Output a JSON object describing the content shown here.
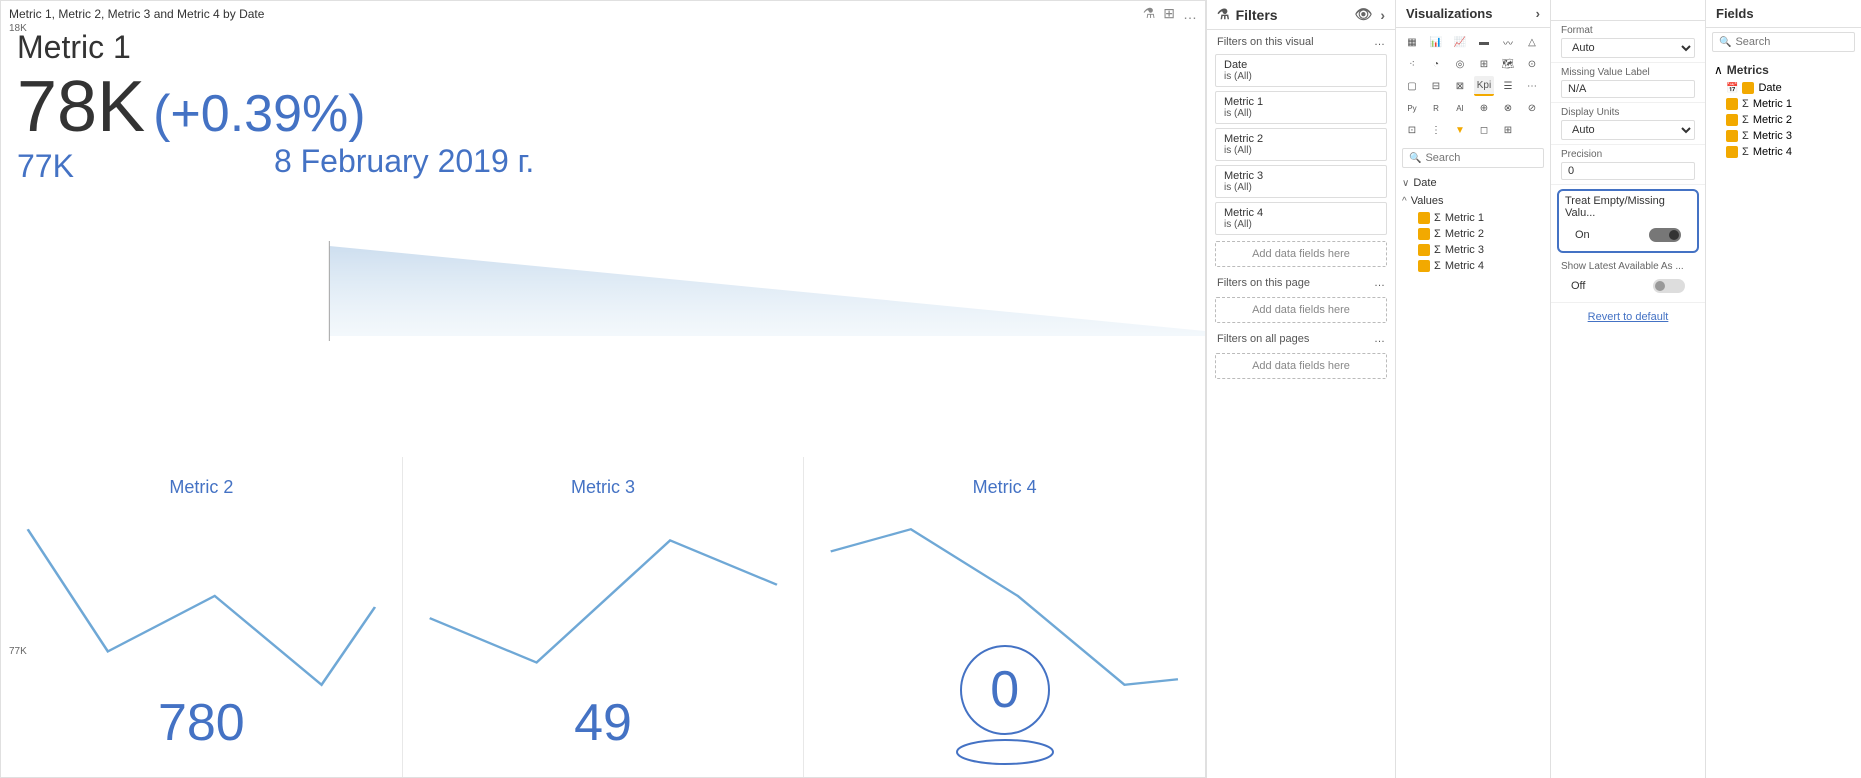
{
  "chart": {
    "title": "Metric 1, Metric 2, Metric 3 and Metric 4 by Date",
    "y_label_top": "18K",
    "y_label_bottom": "77K",
    "metric1": {
      "label": "Metric 1",
      "value": "78K",
      "change": "(+0.39%)",
      "prev_value": "77K",
      "date": "8 February 2019 г."
    },
    "metrics": [
      {
        "label": "Metric 2",
        "value": "780"
      },
      {
        "label": "Metric 3",
        "value": "49"
      },
      {
        "label": "Metric 4",
        "value": "0"
      }
    ]
  },
  "filters": {
    "title": "Filters",
    "section_visual": "Filters on this visual",
    "section_page": "Filters on this page",
    "section_all": "Filters on all pages",
    "items": [
      {
        "name": "Date",
        "value": "is (All)"
      },
      {
        "name": "Metric 1",
        "value": "is (All)"
      },
      {
        "name": "Metric 2",
        "value": "is (All)"
      },
      {
        "name": "Metric 3",
        "value": "is (All)"
      },
      {
        "name": "Metric 4",
        "value": "is (All)"
      }
    ],
    "add_fields_label": "Add data fields here"
  },
  "visualizations": {
    "title": "Visualizations",
    "search_placeholder": "Search",
    "fields": {
      "date_label": "Date",
      "values_label": "Values",
      "metrics": [
        "Metric 1",
        "Metric 2",
        "Metric 3",
        "Metric 4"
      ]
    },
    "format_label": "Format",
    "format_value": "Auto",
    "missing_label": "Missing Value Label",
    "missing_value": "N/A",
    "display_units_label": "Display Units",
    "display_units_value": "Auto",
    "precision_label": "Precision",
    "precision_value": "0",
    "treat_missing_label": "Treat Empty/Missing Valu...",
    "treat_missing_on": "On",
    "show_latest_label": "Show Latest Available As ...",
    "show_latest_off": "Off",
    "revert_label": "Revert to default"
  },
  "fields_panel": {
    "title": "Fields",
    "search_placeholder": "Search"
  }
}
